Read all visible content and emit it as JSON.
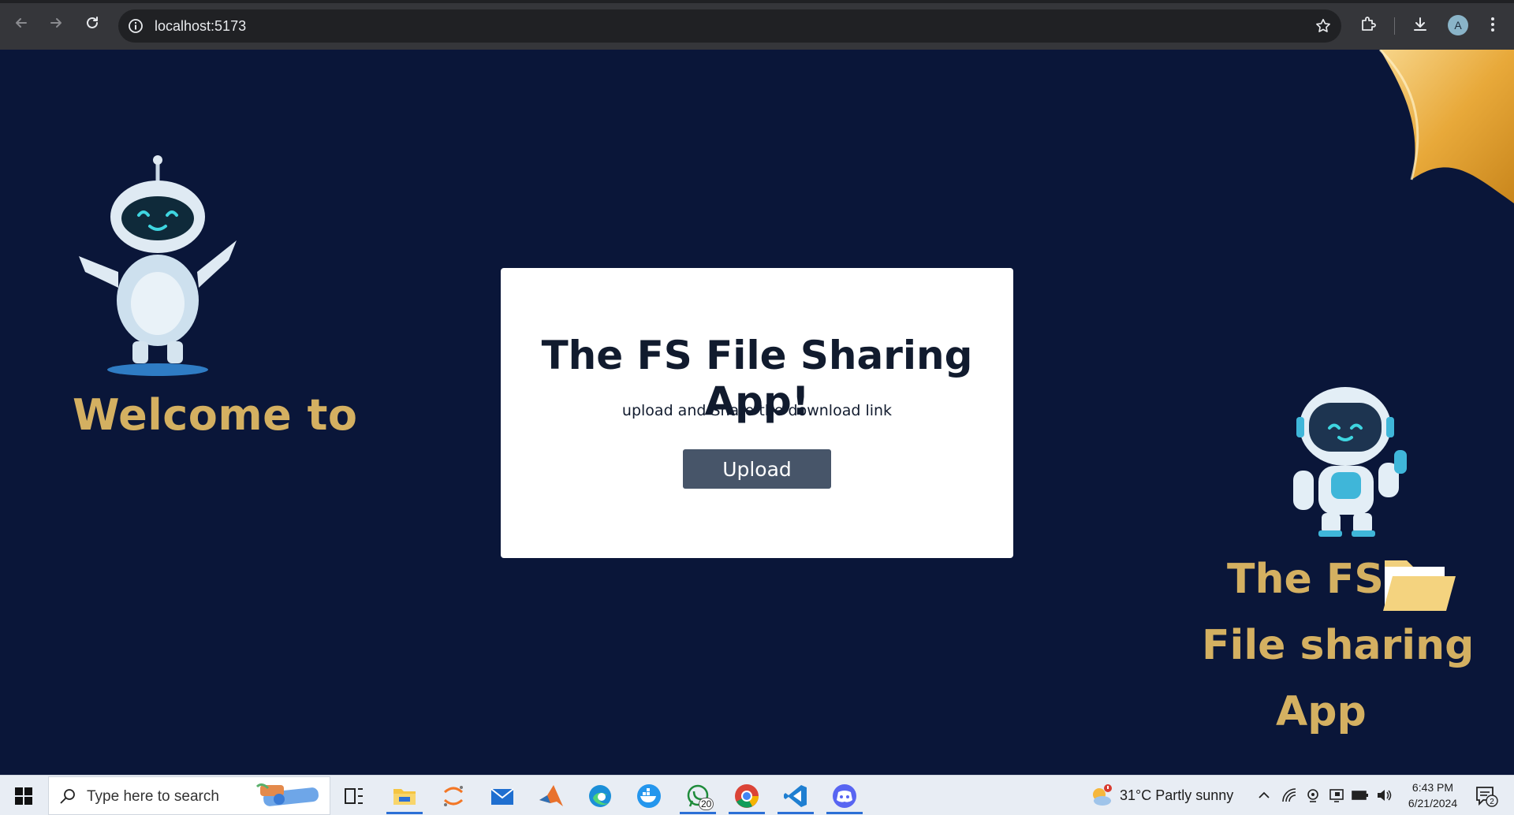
{
  "browser": {
    "url": "localhost:5173",
    "profile_initial": "A"
  },
  "page": {
    "welcome_text": "Welcome to",
    "card": {
      "title": "The FS File Sharing App!",
      "subtitle": "upload and Share the download link",
      "upload_label": "Upload"
    },
    "brand": {
      "line1": "The FS",
      "line2": "File sharing",
      "line3": "App"
    }
  },
  "taskbar": {
    "search_placeholder": "Type here to search",
    "whatsapp_badge": "20",
    "weather": "31°C  Partly sunny",
    "time": "6:43 PM",
    "date": "6/21/2024",
    "notification_count": "2"
  },
  "colors": {
    "page_bg": "#0a1639",
    "accent_gold": "#d4b061",
    "button_bg": "#475569"
  }
}
